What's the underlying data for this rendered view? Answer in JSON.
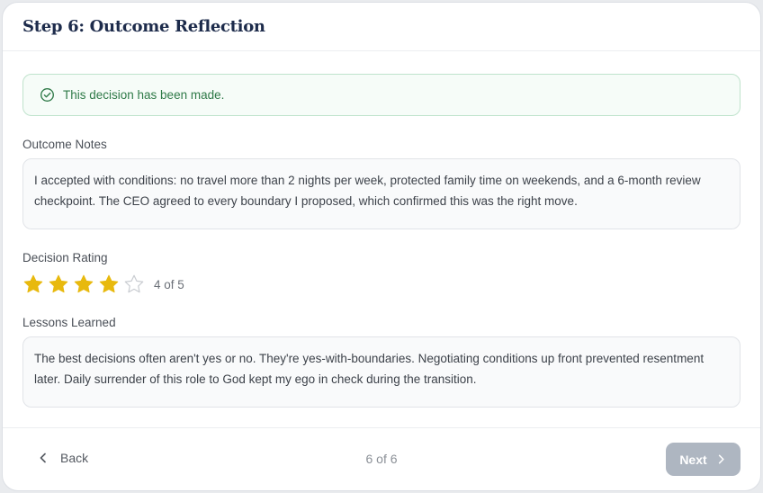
{
  "header": {
    "title": "Step 6: Outcome Reflection"
  },
  "alert": {
    "text": "This decision has been made.",
    "icon": "check-circle-icon",
    "color": "#2f7a48"
  },
  "outcome": {
    "label": "Outcome Notes",
    "value": "I accepted with conditions: no travel more than 2 nights per week, protected family time on weekends, and a 6-month review checkpoint. The CEO agreed to every boundary I proposed, which confirmed this was the right move."
  },
  "rating": {
    "label": "Decision Rating",
    "value": 4,
    "max": 5,
    "text": "4 of 5",
    "star_color": "#e8b90e"
  },
  "lessons": {
    "label": "Lessons Learned",
    "value": "The best decisions often aren't yes or no. They're yes-with-boundaries. Negotiating conditions up front prevented resentment later. Daily surrender of this role to God kept my ego in check during the transition."
  },
  "footer": {
    "back_label": "Back",
    "step_text": "6 of 6",
    "next_label": "Next"
  }
}
